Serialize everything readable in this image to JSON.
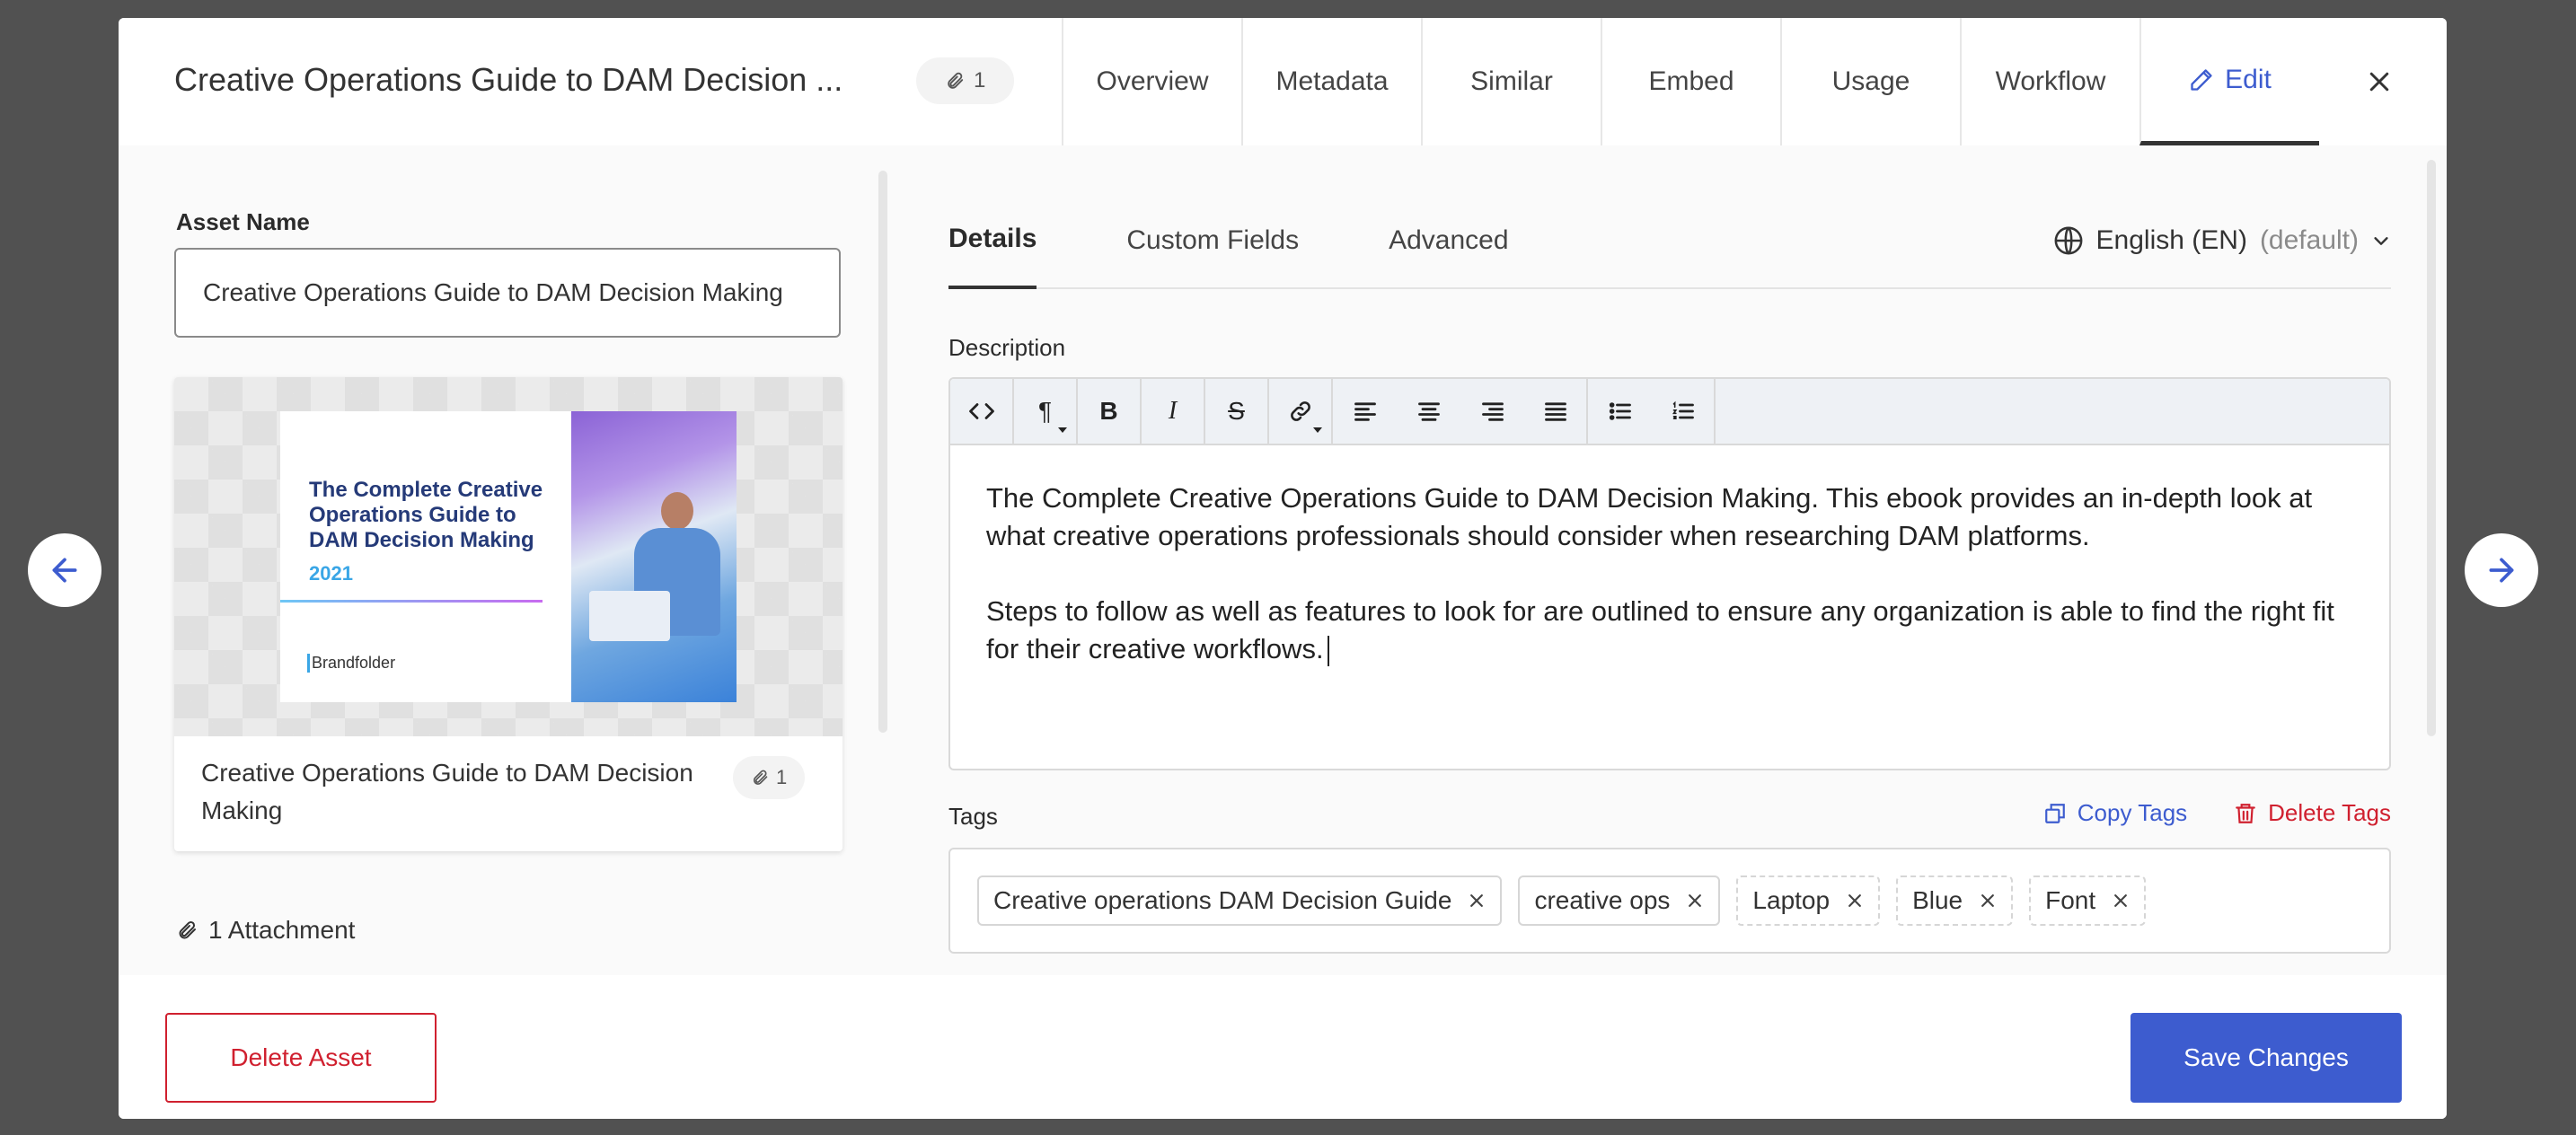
{
  "header": {
    "title": "Creative Operations Guide to DAM Decision ...",
    "attachment_count": "1",
    "tabs": [
      {
        "label": "Overview"
      },
      {
        "label": "Metadata"
      },
      {
        "label": "Similar"
      },
      {
        "label": "Embed"
      },
      {
        "label": "Usage"
      },
      {
        "label": "Workflow"
      },
      {
        "label": "Edit",
        "active": true
      }
    ]
  },
  "left": {
    "asset_name_label": "Asset Name",
    "asset_name_value": "Creative Operations Guide to DAM Decision Making",
    "thumbnail": {
      "cover_title": "The Complete Creative Operations Guide to DAM Decision Making",
      "cover_year": "2021",
      "cover_brand": "Brandfolder",
      "caption": "Creative Operations Guide to DAM Decision Making",
      "attachment_count": "1"
    },
    "attachments_link": "1 Attachment"
  },
  "right": {
    "subtabs": [
      {
        "label": "Details",
        "active": true
      },
      {
        "label": "Custom Fields"
      },
      {
        "label": "Advanced"
      }
    ],
    "language": {
      "label": "English (EN)",
      "suffix": "(default)"
    },
    "description_label": "Description",
    "toolbar_icons": [
      "code-icon",
      "paragraph-icon",
      "bold-icon",
      "italic-icon",
      "strikethrough-icon",
      "link-icon",
      "align-left-icon",
      "align-center-icon",
      "align-right-icon",
      "align-justify-icon",
      "bullet-list-icon",
      "numbered-list-icon"
    ],
    "description": {
      "p1": "The Complete Creative Operations Guide to DAM Decision Making. This ebook provides an in-depth look at what creative operations professionals should consider when researching DAM platforms.",
      "p2": "Steps to follow as well as features to look for are outlined to ensure any organization is able to find the right fit for their creative workflows."
    },
    "tags_label": "Tags",
    "copy_tags": "Copy Tags",
    "delete_tags": "Delete Tags",
    "tags": [
      {
        "label": "Creative operations DAM Decision Guide",
        "style": "solid"
      },
      {
        "label": "creative ops",
        "style": "solid"
      },
      {
        "label": "Laptop",
        "style": "dashed"
      },
      {
        "label": "Blue",
        "style": "dashed"
      },
      {
        "label": "Font",
        "style": "dashed"
      }
    ]
  },
  "footer": {
    "delete_asset": "Delete Asset",
    "save_changes": "Save Changes"
  },
  "colors": {
    "accent": "#3d5ccf",
    "danger": "#d0202f",
    "overlay": "#515151"
  }
}
